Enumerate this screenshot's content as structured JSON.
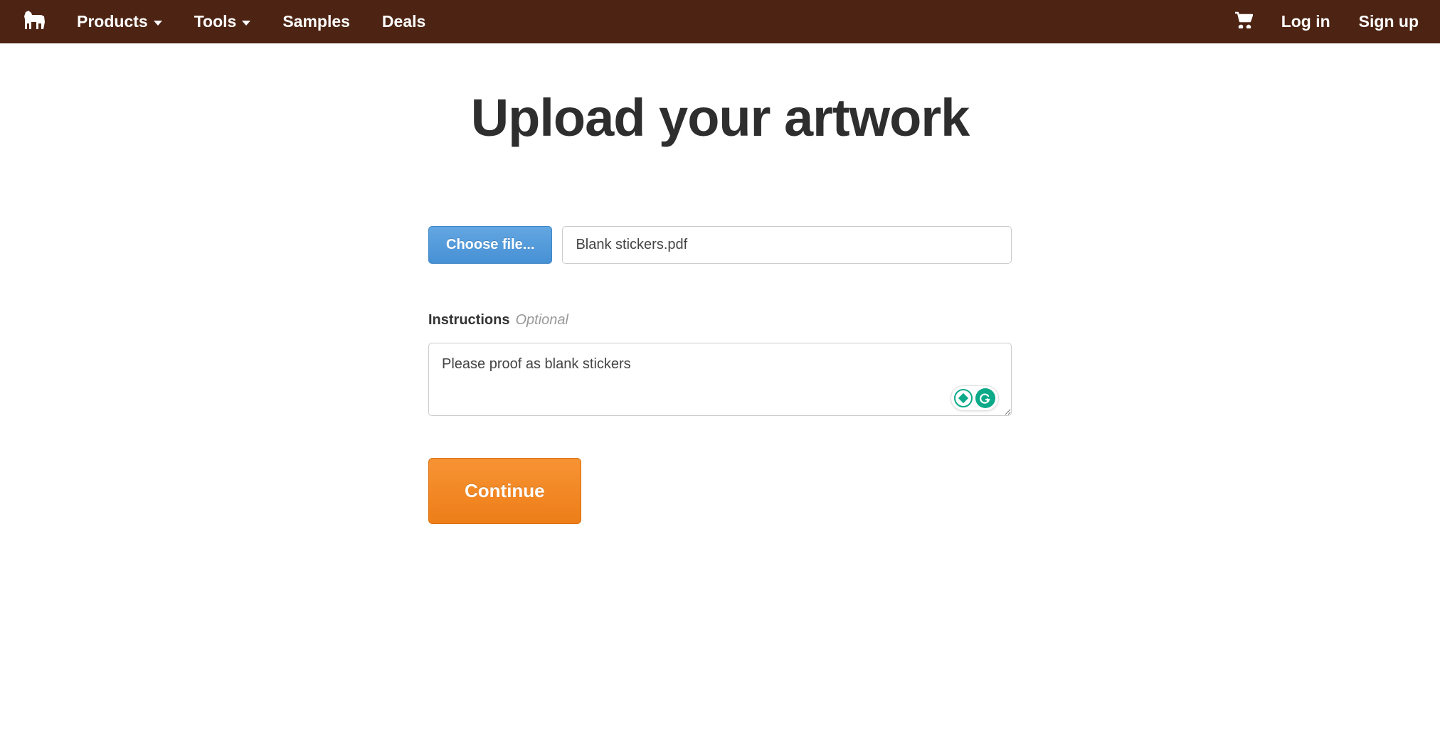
{
  "nav": {
    "products": "Products",
    "tools": "Tools",
    "samples": "Samples",
    "deals": "Deals",
    "login": "Log in",
    "signup": "Sign up"
  },
  "page": {
    "title": "Upload your artwork",
    "choose_file": "Choose file...",
    "file_name": "Blank stickers.pdf",
    "instructions_label": "Instructions",
    "optional": "Optional",
    "instructions_value": "Please proof as blank stickers",
    "continue": "Continue"
  }
}
